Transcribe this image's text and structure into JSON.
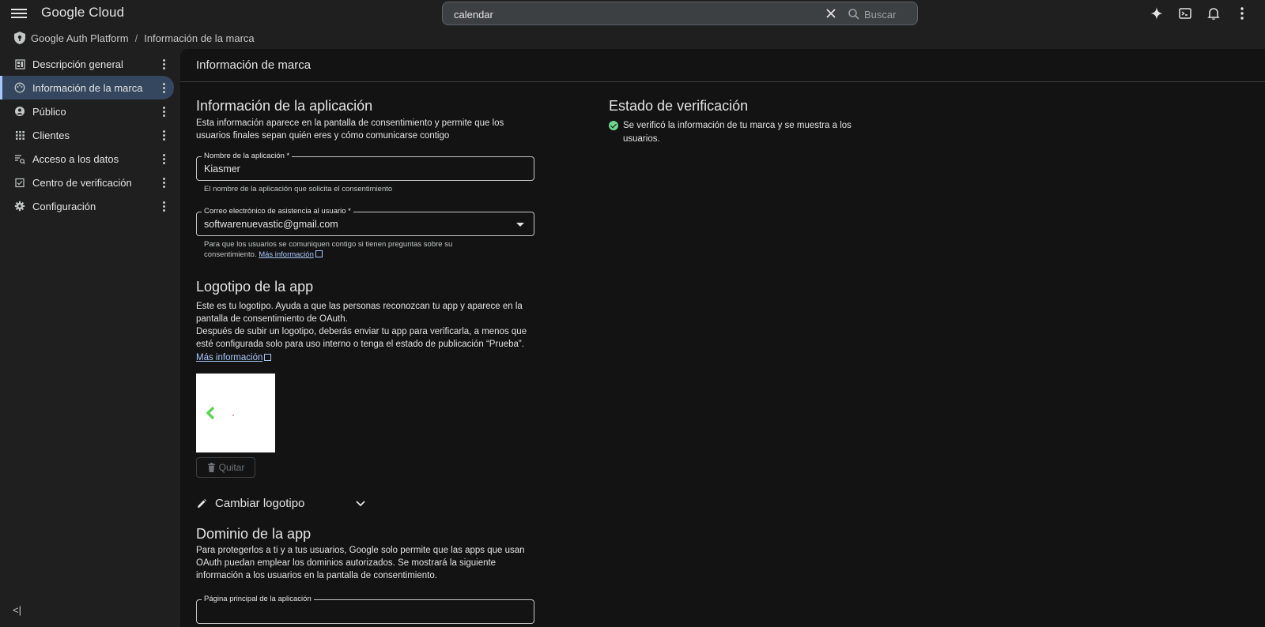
{
  "topbar": {
    "brand": "Google Cloud",
    "search_value": "calendar",
    "search_button": "Buscar",
    "icons": [
      "gemini-icon",
      "terminal-icon",
      "bell-icon",
      "more-vert-icon"
    ]
  },
  "breadcrumb": {
    "product": "Google Auth Platform",
    "current": "Información de la marca"
  },
  "sidebar": {
    "items": [
      {
        "label": "Descripción general",
        "icon": "dashboard-icon"
      },
      {
        "label": "Información de la marca",
        "icon": "palette-icon",
        "active": true
      },
      {
        "label": "Público",
        "icon": "person-icon"
      },
      {
        "label": "Clientes",
        "icon": "grid-icon"
      },
      {
        "label": "Acceso a los datos",
        "icon": "data-access-icon"
      },
      {
        "label": "Centro de verificación",
        "icon": "verification-icon"
      },
      {
        "label": "Configuración",
        "icon": "gear-icon"
      }
    ],
    "collapse_label": "<|"
  },
  "page": {
    "header": "Información de marca",
    "app_info": {
      "title": "Información de la aplicación",
      "desc": "Esta información aparece en la pantalla de consentimiento y permite que los usuarios finales sepan quién eres y cómo comunicarse contigo",
      "app_name_label": "Nombre de la aplicación *",
      "app_name_value": "Kiasmer",
      "app_name_helper": "El nombre de la aplicación que solicita el consentimiento",
      "email_label": "Correo electrónico de asistencia al usuario *",
      "email_value": "softwarenuevastic@gmail.com",
      "email_helper": "Para que los usuarios se comuniquen contigo si tienen preguntas sobre su consentimiento.",
      "more_info": "Más información"
    },
    "logo": {
      "title": "Logotipo de la app",
      "desc1": "Este es tu logotipo. Ayuda a que las personas reconozcan tu app y aparece en la pantalla de consentimiento de OAuth.",
      "desc2": "Después de subir un logotipo, deberás enviar tu app para verificarla, a menos que esté configurada solo para uso interno o tenga el estado de publicación “Prueba”.",
      "more_info": "Más información",
      "remove_label": "Quitar",
      "change_label": "Cambiar logotipo"
    },
    "domain": {
      "title": "Dominio de la app",
      "desc": "Para protegerlos a ti y a tus usuarios, Google solo permite que las apps que usan OAuth puedan emplear los dominios autorizados. Se mostrará la siguiente información a los usuarios en la pantalla de consentimiento.",
      "homepage_label": "Página principal de la aplicación"
    },
    "verification": {
      "title": "Estado de verificación",
      "status": "Se verificó la información de tu marca y se muestra a los usuarios."
    }
  },
  "colors": {
    "accent": "#a8c7fa",
    "success": "#6dd58c",
    "active_nav": "#34475e"
  }
}
